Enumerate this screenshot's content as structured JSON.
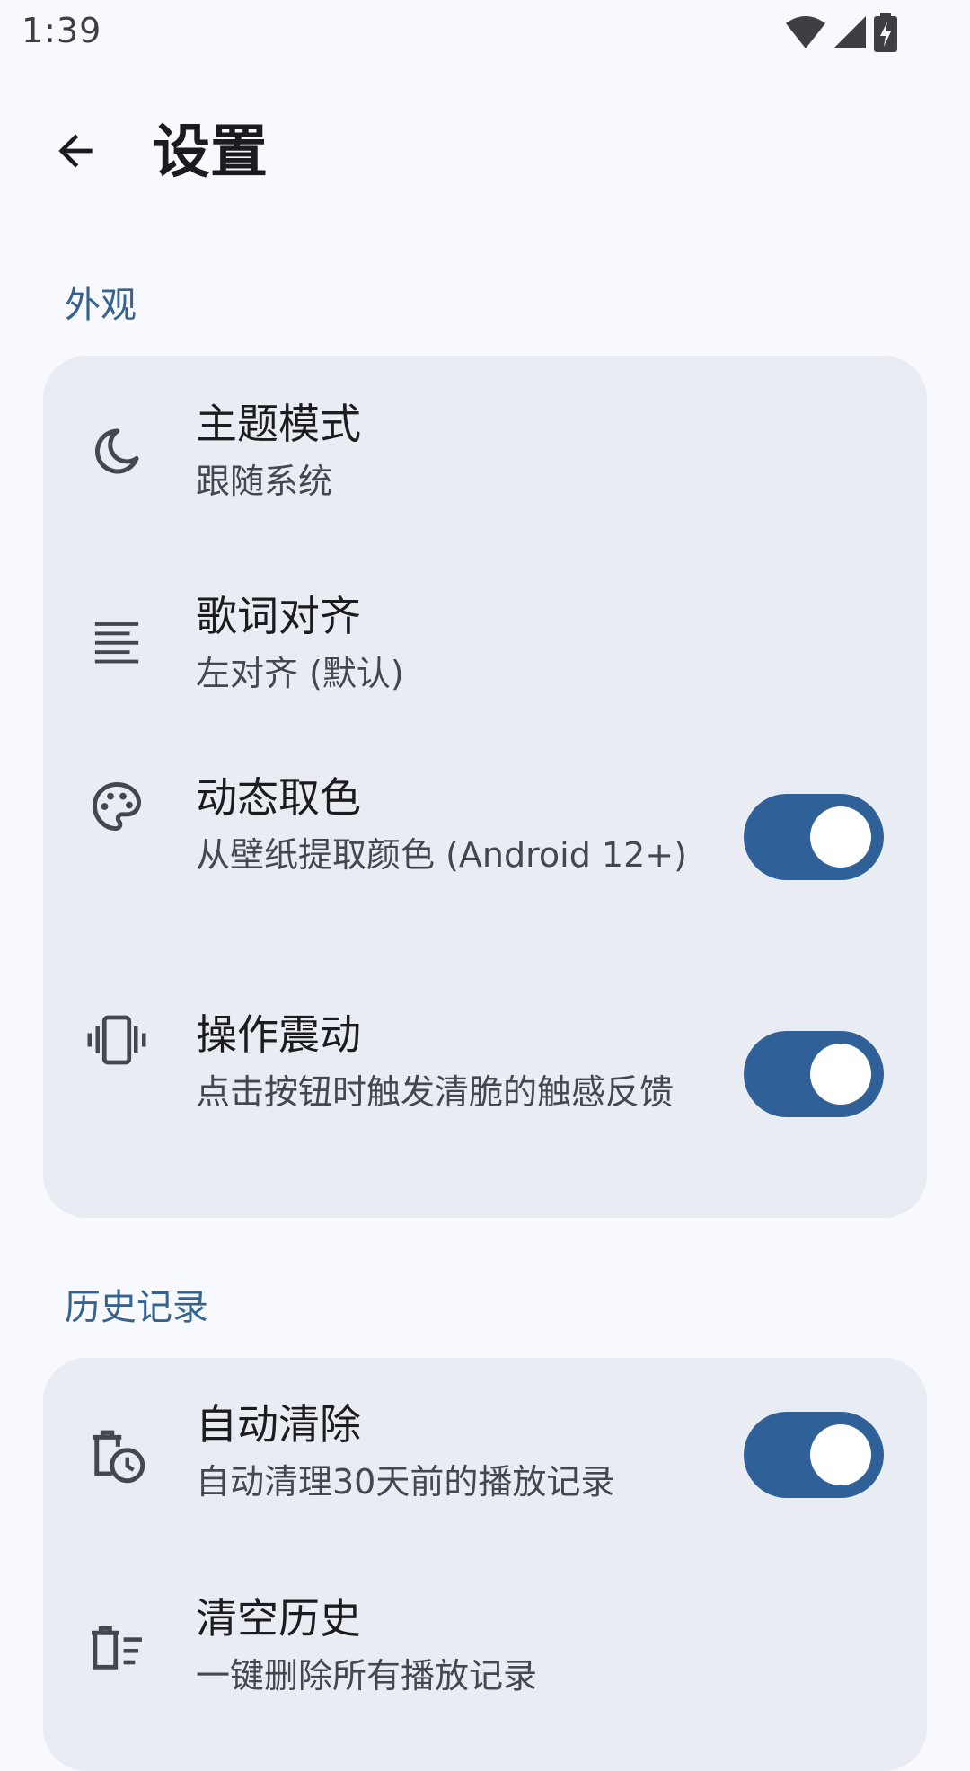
{
  "status_bar": {
    "time": "1:39",
    "icons": [
      "wifi-icon",
      "signal-icon",
      "battery-charging-icon"
    ]
  },
  "app_bar": {
    "back_icon": "arrow-back-icon",
    "title": "设置"
  },
  "sections": {
    "appearance": {
      "header": "外观",
      "theme_mode": {
        "icon": "moon-icon",
        "title": "主题模式",
        "subtitle": "跟随系统"
      },
      "lyrics_align": {
        "icon": "align-left-icon",
        "title": "歌词对齐",
        "subtitle": "左对齐 (默认)"
      },
      "dynamic_color": {
        "icon": "palette-icon",
        "title": "动态取色",
        "subtitle": "从壁纸提取颜色 (Android 12+)",
        "enabled": true
      },
      "haptics": {
        "icon": "vibration-icon",
        "title": "操作震动",
        "subtitle": "点击按钮时触发清脆的触感反馈",
        "enabled": true
      }
    },
    "history": {
      "header": "历史记录",
      "auto_clear": {
        "icon": "delete-clock-icon",
        "title": "自动清除",
        "subtitle": "自动清理30天前的播放记录",
        "enabled": true
      },
      "clear_history": {
        "icon": "delete-sweep-icon",
        "title": "清空历史",
        "subtitle": "一键删除所有播放记录"
      }
    }
  },
  "colors": {
    "background": "#f7f9fe",
    "card": "#e9ecf3",
    "accent": "#2f6198",
    "section_header": "#36628f"
  }
}
